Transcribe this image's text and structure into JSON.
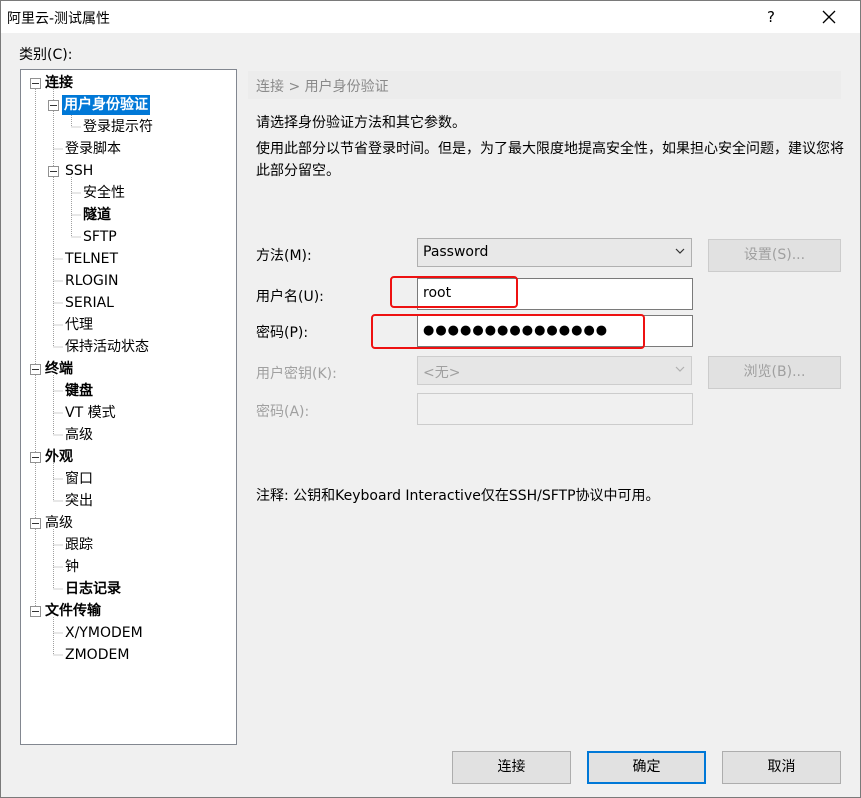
{
  "window": {
    "title": "阿里云-测试属性",
    "help_label": "?"
  },
  "category_label": "类别(C):",
  "tree": [
    {
      "label": "连接",
      "bold": true
    },
    {
      "label": "用户身份验证",
      "bold": true,
      "selected": true
    },
    {
      "label": "登录提示符"
    },
    {
      "label": "登录脚本"
    },
    {
      "label": "SSH"
    },
    {
      "label": "安全性"
    },
    {
      "label": "隧道",
      "bold": true
    },
    {
      "label": "SFTP"
    },
    {
      "label": "TELNET"
    },
    {
      "label": "RLOGIN"
    },
    {
      "label": "SERIAL"
    },
    {
      "label": "代理"
    },
    {
      "label": "保持活动状态"
    },
    {
      "label": "终端",
      "bold": true
    },
    {
      "label": "键盘",
      "bold": true
    },
    {
      "label": "VT 模式"
    },
    {
      "label": "高级"
    },
    {
      "label": "外观",
      "bold": true
    },
    {
      "label": "窗口"
    },
    {
      "label": "突出"
    },
    {
      "label": "高级"
    },
    {
      "label": "跟踪"
    },
    {
      "label": "钟"
    },
    {
      "label": "日志记录",
      "bold": true
    },
    {
      "label": "文件传输",
      "bold": true
    },
    {
      "label": "X/YMODEM"
    },
    {
      "label": "ZMODEM"
    }
  ],
  "section": {
    "breadcrumb": "连接 > 用户身份验证",
    "desc1": "请选择身份验证方法和其它参数。",
    "desc2": "使用此部分以节省登录时间。但是，为了最大限度地提高安全性，如果担心安全问题，建议您将此部分留空。"
  },
  "form": {
    "method_label": "方法(M):",
    "method_value": "Password",
    "settings_button": "设置(S)...",
    "username_label": "用户名(U):",
    "username_value": "root",
    "password_label": "密码(P):",
    "password_value": "●●●●●●●●●●●●●●●",
    "userkey_label": "用户密钥(K):",
    "userkey_value": "<无>",
    "browse_button": "浏览(B)...",
    "passphrase_label": "密码(A):",
    "passphrase_value": ""
  },
  "note": "注释: 公钥和Keyboard Interactive仅在SSH/SFTP协议中可用。",
  "buttons": {
    "connect": "连接",
    "ok": "确定",
    "cancel": "取消"
  },
  "colors": {
    "selection": "#0078d7",
    "highlight": "#ee1111"
  }
}
